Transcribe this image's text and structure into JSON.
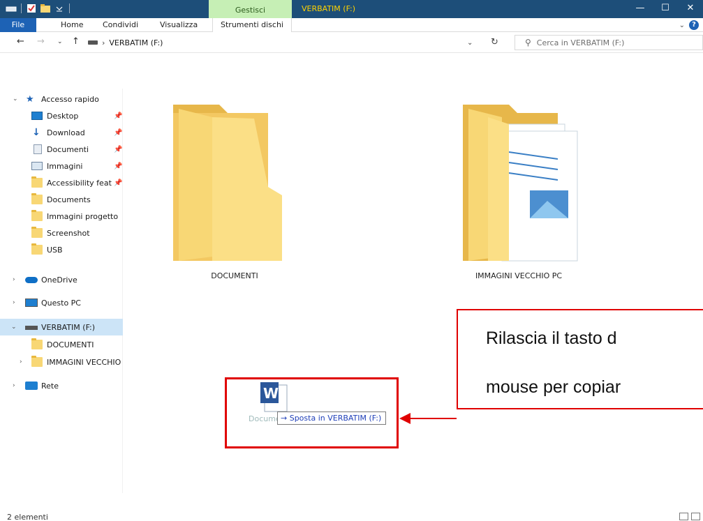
{
  "titlebar": {
    "context_group": "Gestisci",
    "window_title": "VERBATIM (F:)",
    "minimize": "—",
    "maximize": "☐",
    "close": "✕"
  },
  "ribbon": {
    "tabs": [
      "File",
      "Home",
      "Condividi",
      "Visualizza"
    ],
    "context_tab": "Strumenti dischi",
    "help": "?"
  },
  "address": {
    "path_segment": "VERBATIM (F:)",
    "search_placeholder": "Cerca in VERBATIM (F:)"
  },
  "sidebar": {
    "quick_access": "Accesso rapido",
    "pinned": [
      "Desktop",
      "Download",
      "Documenti",
      "Immagini",
      "Accessibility feat"
    ],
    "folders": [
      "Documents",
      "Immagini progetto",
      "Screenshot",
      "USB"
    ],
    "onedrive": "OneDrive",
    "this_pc": "Questo PC",
    "drive": "VERBATIM (F:)",
    "drive_children": [
      "DOCUMENTI",
      "IMMAGINI VECCHIO"
    ],
    "network": "Rete"
  },
  "main": {
    "folders": [
      "DOCUMENTI",
      "IMMAGINI VECCHIO PC"
    ],
    "drag_tooltip": "Sposta in VERBATIM (F:)",
    "drag_item": "Documento 1",
    "drag_arrow": "→"
  },
  "annotation": {
    "line1": "Rilascia il tasto d",
    "line2": "mouse per copiar"
  },
  "status": {
    "count": "2 elementi"
  },
  "colors": {
    "titlebar": "#1d4e79",
    "context_tab": "#c6efb5",
    "title_text": "#ffd200",
    "file_tab": "#1d62b5",
    "selected": "#cce4f7",
    "annotation": "#e00000",
    "folder": "#f8d775"
  }
}
